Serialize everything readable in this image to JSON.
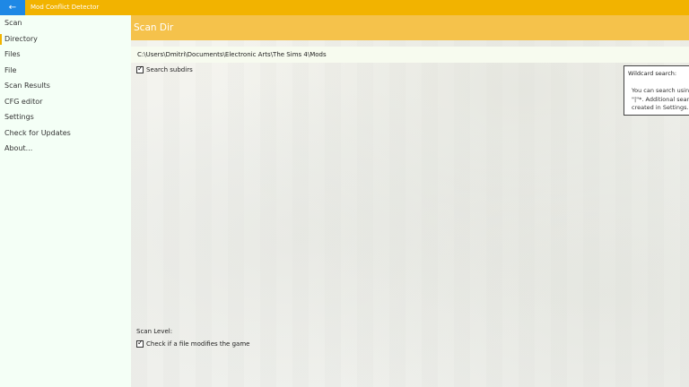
{
  "titlebar": {
    "back_icon": "←",
    "app_title": "Mod Conflict Detector",
    "accent": "#f2b300",
    "back_color": "#1e88e5"
  },
  "sidebar": {
    "items": [
      {
        "label": "Scan"
      },
      {
        "label": "Directory"
      },
      {
        "label": "Files"
      },
      {
        "label": "File"
      },
      {
        "label": "Scan Results"
      },
      {
        "label": "CFG editor"
      },
      {
        "label": "Settings"
      },
      {
        "label": "Check for Updates"
      },
      {
        "label": "About..."
      }
    ],
    "active_index": 1
  },
  "main": {
    "header_title": "Scan Dir",
    "header_color": "#f5c24b",
    "path": "C:\\Users\\Dmitri\\Documents\\Electronic Arts\\The Sims 4\\Mods",
    "search_subdirs_label": "Search subdirs",
    "search_subdirs_checked": true,
    "wildcard": {
      "label": "Wildcard search:",
      "value": "*",
      "help_lines": [
        "You can search using",
        "\"|\"*. Additional search",
        "created in Settings."
      ]
    },
    "scan_level_label": "Scan Level:",
    "check_modifies_label": "Check if a file modifies the game",
    "check_modifies_checked": true
  }
}
